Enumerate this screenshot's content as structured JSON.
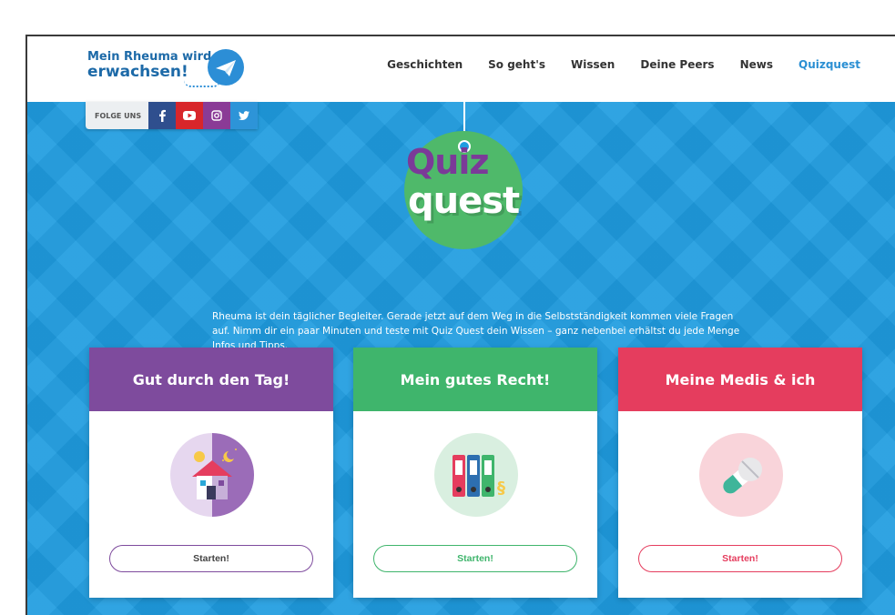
{
  "header": {
    "logo_line1": "Mein Rheuma wird",
    "logo_line2": "erwachsen!",
    "nav": [
      "Geschichten",
      "So geht's",
      "Wissen",
      "Deine Peers",
      "News",
      "Quizquest"
    ],
    "active_nav": "Quizquest"
  },
  "social": {
    "label": "FOLGE UNS",
    "icons": [
      "facebook-icon",
      "youtube-icon",
      "instagram-icon",
      "twitter-icon"
    ]
  },
  "hero": {
    "logo_word1": "Quiz",
    "logo_word2": "quest",
    "intro": "Rheuma ist dein täglicher Begleiter. Gerade jetzt auf dem Weg in die Selbstständigkeit kommen viele Fragen auf. Nimm dir ein paar Minuten und teste mit Quiz Quest dein Wissen – ganz nebenbei erhältst du jede Menge Infos und Tipps."
  },
  "cards": [
    {
      "title": "Gut durch den Tag!",
      "button": "Starten!",
      "icon": "house-day-night-icon",
      "color": "#7e4b9d"
    },
    {
      "title": "Mein gutes Recht!",
      "button": "Starten!",
      "icon": "binders-icon",
      "color": "#3fb56c"
    },
    {
      "title": "Meine Medis & ich",
      "button": "Starten!",
      "icon": "pills-icon",
      "color": "#e53d5e"
    }
  ],
  "colors": {
    "hero_blue": "#1f9ce0",
    "brand_blue": "#1d6aa8",
    "active_nav": "#2a8fd3"
  }
}
